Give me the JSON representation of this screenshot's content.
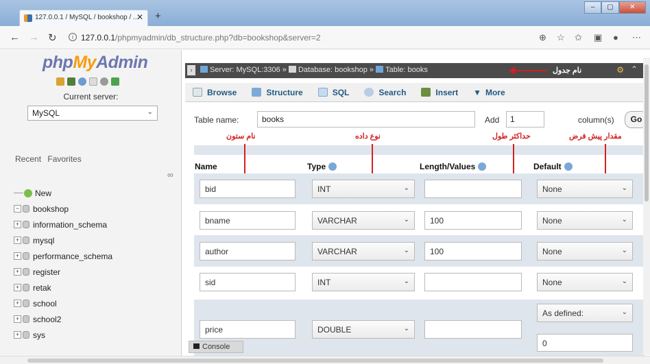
{
  "browser": {
    "tab_title": "127.0.0.1 / MySQL / bookshop / ...",
    "url_host": "127.0.0.1",
    "url_path": "/phpmyadmin/db_structure.php?db=bookshop&server=2"
  },
  "sidebar": {
    "logo_php": "php",
    "logo_my": "My",
    "logo_admin": "Admin",
    "current_server_label": "Current server:",
    "server_value": "MySQL",
    "recent": "Recent",
    "favorites": "Favorites",
    "tree": [
      "New",
      "bookshop",
      "information_schema",
      "mysql",
      "performance_schema",
      "register",
      "retak",
      "school",
      "school2",
      "sys"
    ]
  },
  "breadcrumb": {
    "server": "Server: MySQL:3306",
    "database": "Database: bookshop",
    "table": "Table: books",
    "annotation": "نام جدول"
  },
  "tabs": [
    "Browse",
    "Structure",
    "SQL",
    "Search",
    "Insert",
    "More"
  ],
  "form": {
    "table_name_label": "Table name:",
    "table_name_value": "books",
    "add_label": "Add",
    "add_value": "1",
    "columns_label": "column(s)",
    "go_label": "Go"
  },
  "annotations": {
    "name": "نام ستون",
    "type": "نوع داده",
    "length": "حداکثر طول",
    "default": "مقدار پیش فرض"
  },
  "headers": {
    "name": "Name",
    "type": "Type",
    "length": "Length/Values",
    "default": "Default"
  },
  "rows": [
    {
      "name": "bid",
      "type": "INT",
      "length": "",
      "default": "None"
    },
    {
      "name": "bname",
      "type": "VARCHAR",
      "length": "100",
      "default": "None"
    },
    {
      "name": "author",
      "type": "VARCHAR",
      "length": "100",
      "default": "None"
    },
    {
      "name": "sid",
      "type": "INT",
      "length": "",
      "default": "None"
    },
    {
      "name": "price",
      "type": "DOUBLE",
      "length": "",
      "default": "As defined:",
      "default_value": "0"
    }
  ],
  "console_label": "Console"
}
